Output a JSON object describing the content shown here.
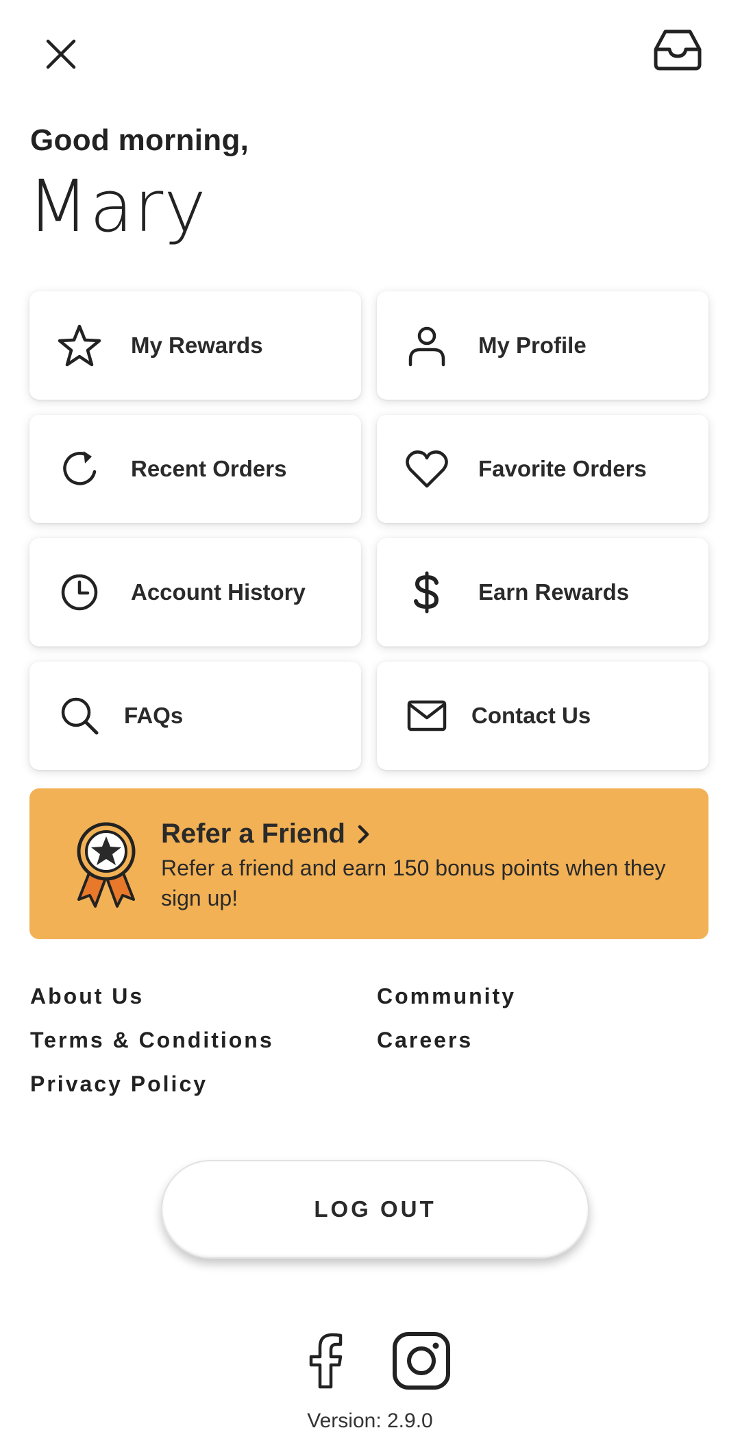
{
  "header": {
    "close_icon": "close-icon",
    "inbox_icon": "inbox-icon"
  },
  "greeting": {
    "salutation": "Good morning,",
    "name": "Mary"
  },
  "menu": {
    "items": [
      {
        "label": "My Rewards",
        "icon": "star-icon"
      },
      {
        "label": "My Profile",
        "icon": "user-icon"
      },
      {
        "label": "Recent Orders",
        "icon": "refresh-icon"
      },
      {
        "label": "Favorite Orders",
        "icon": "heart-icon"
      },
      {
        "label": "Account History",
        "icon": "clock-icon"
      },
      {
        "label": "Earn Rewards",
        "icon": "dollar-icon"
      },
      {
        "label": "FAQs",
        "icon": "search-icon"
      },
      {
        "label": "Contact Us",
        "icon": "mail-icon"
      }
    ]
  },
  "refer": {
    "title": "Refer a Friend",
    "body": "Refer a friend and earn 150 bonus points when they sign up!",
    "color": "#f2b155"
  },
  "footer_links": {
    "about": "About Us",
    "community": "Community",
    "terms": "Terms & Conditions",
    "careers": "Careers",
    "privacy": "Privacy Policy"
  },
  "logout": {
    "label": "LOG OUT"
  },
  "social": {
    "facebook_icon": "facebook-icon",
    "instagram_icon": "instagram-icon"
  },
  "version": "Version: 2.9.0"
}
